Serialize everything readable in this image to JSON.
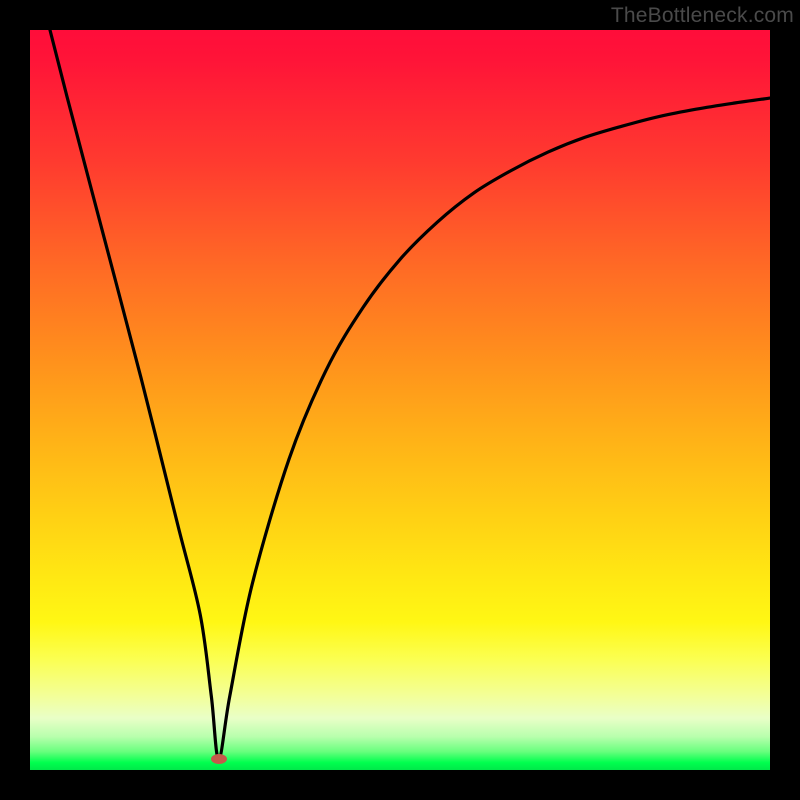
{
  "watermark": {
    "text": "TheBottleneck.com"
  },
  "chart_data": {
    "type": "line",
    "title": "",
    "xlabel": "",
    "ylabel": "",
    "xlim": [
      0,
      100
    ],
    "ylim": [
      0,
      100
    ],
    "grid": false,
    "legend": false,
    "annotations": [],
    "series": [
      {
        "name": "curve",
        "x": [
          2.7,
          5,
          10,
          15,
          20,
          23,
          24.5,
          25.5,
          27,
          30,
          35,
          40,
          45,
          50,
          55,
          60,
          65,
          70,
          75,
          80,
          85,
          90,
          95,
          100
        ],
        "y": [
          100,
          91,
          72,
          53,
          33,
          21,
          10,
          1.5,
          10,
          25,
          42,
          54,
          62.5,
          69,
          74,
          78,
          81,
          83.5,
          85.5,
          87,
          88.3,
          89.3,
          90.1,
          90.8
        ]
      }
    ],
    "marker": {
      "x": 25.5,
      "y": 1.5,
      "color": "#c45a4a"
    },
    "background_gradient": {
      "top": "#ff0d3a",
      "mid": "#ffd114",
      "bottom": "#00e84a"
    }
  }
}
